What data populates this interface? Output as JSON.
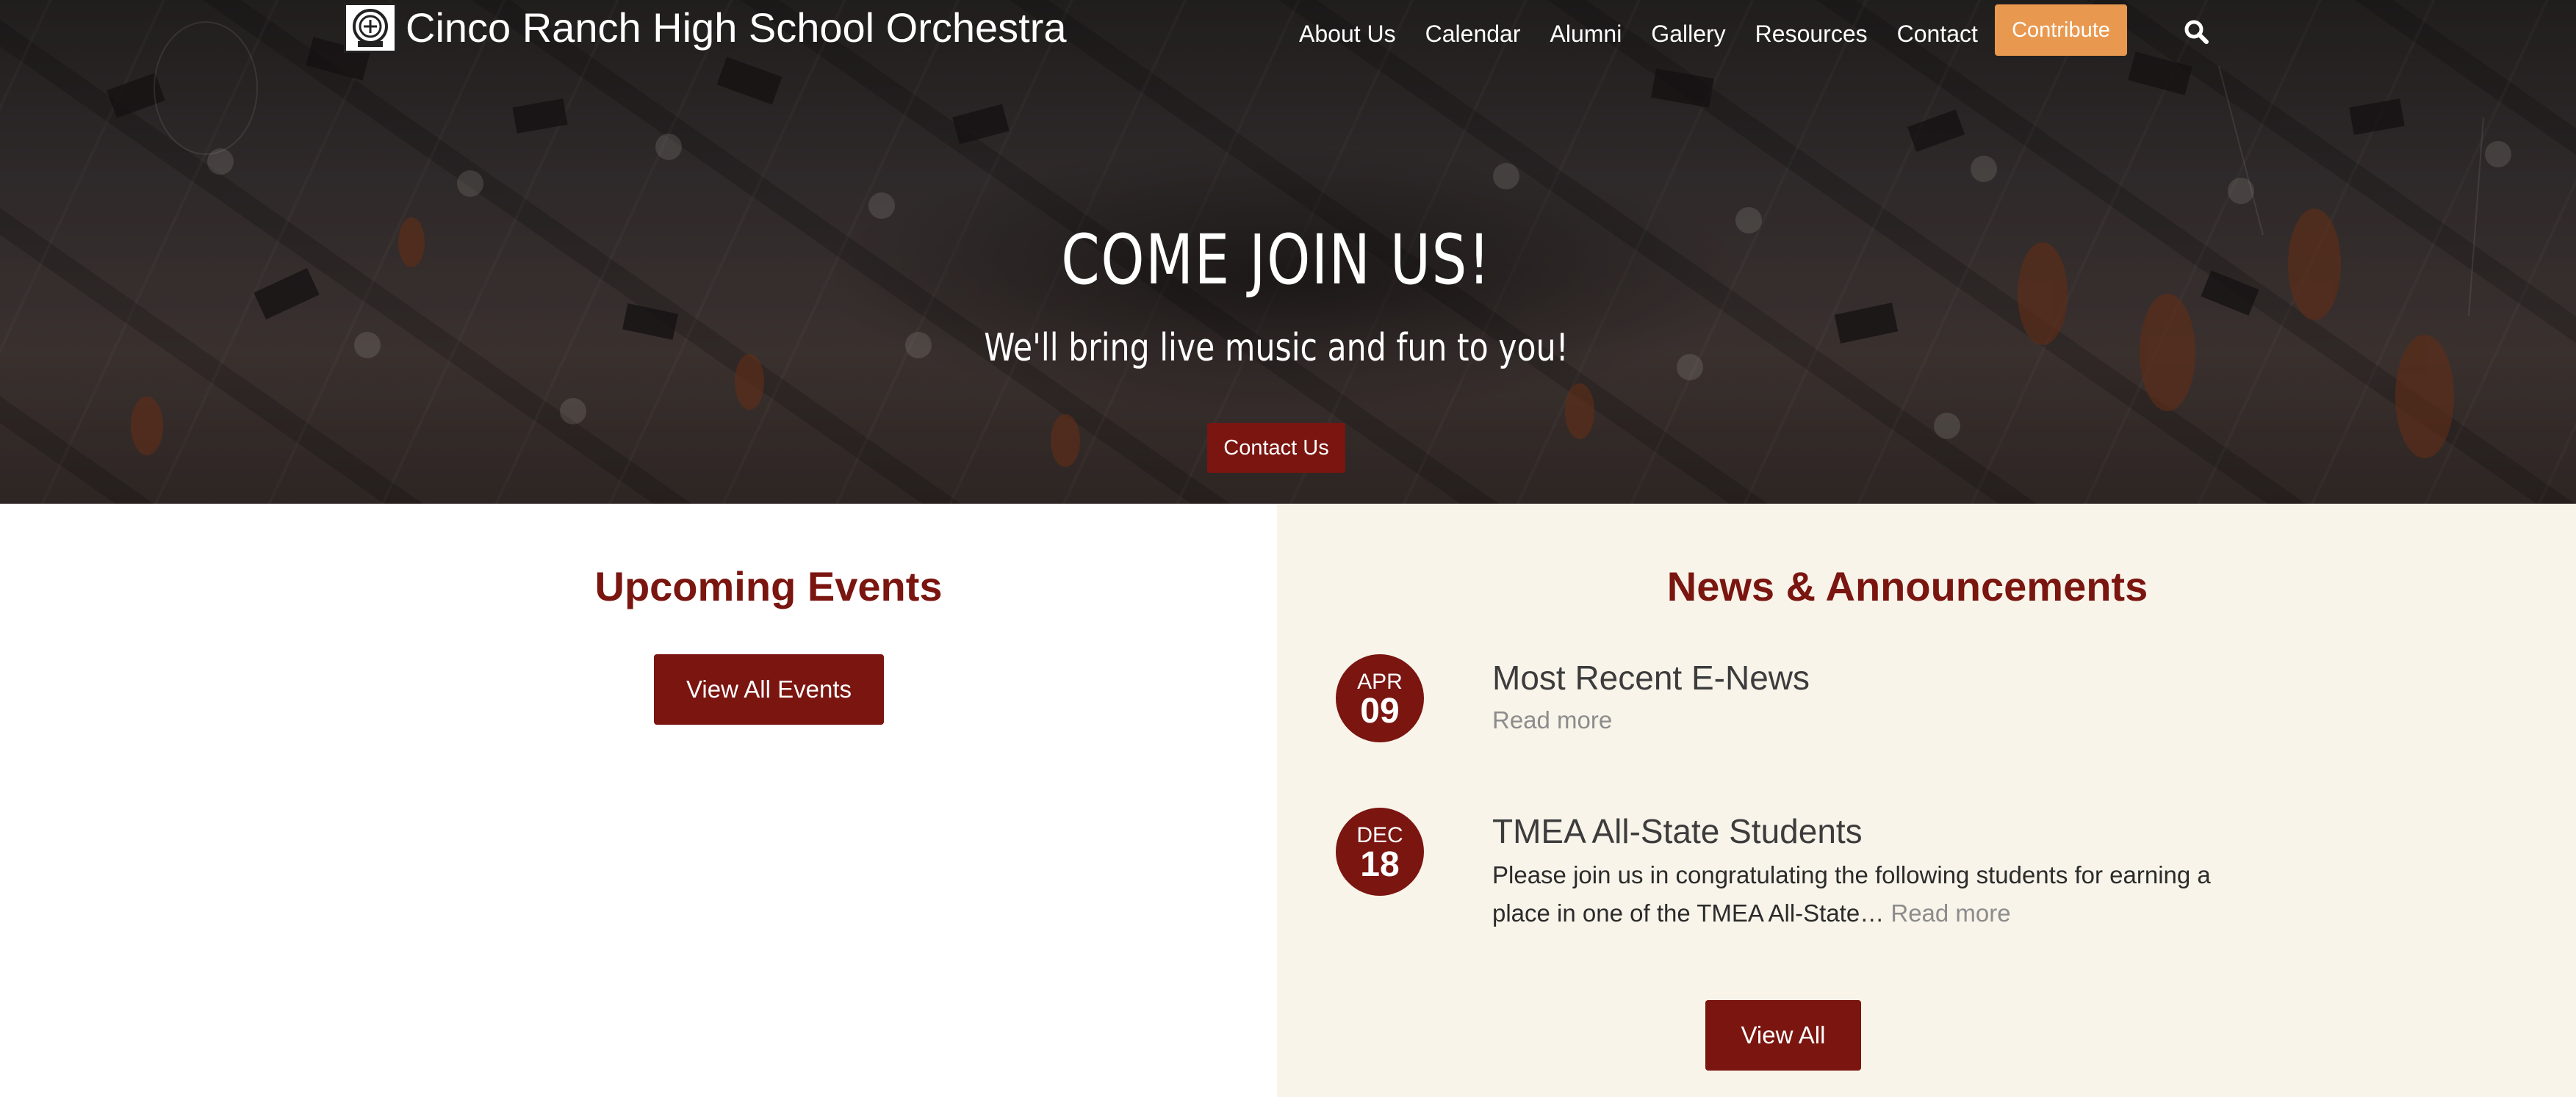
{
  "header": {
    "site_title": "Cinco Ranch High School Orchestra",
    "nav": [
      "About Us",
      "Calendar",
      "Alumni",
      "Gallery",
      "Resources",
      "Contact"
    ],
    "contribute_label": "Contribute",
    "search_icon": "search-icon"
  },
  "hero": {
    "title": "COME JOIN US!",
    "subtitle": "We'll bring live music and fun to you!",
    "cta_label": "Contact Us"
  },
  "events": {
    "heading": "Upcoming Events",
    "view_all_label": "View All Events"
  },
  "news": {
    "heading": "News & Announcements",
    "items": [
      {
        "month": "APR",
        "day": "09",
        "title": "Most Recent E-News",
        "excerpt": "",
        "read_more": "Read more"
      },
      {
        "month": "DEC",
        "day": "18",
        "title": "TMEA All-State Students",
        "excerpt": "Please join us in congratulating the following students for earning a place in one of the TMEA All-State…",
        "read_more": "Read more"
      }
    ],
    "view_all_label": "View All"
  },
  "colors": {
    "primary": "#7a1510",
    "accent": "#e8994f",
    "news_background": "#f9f4ea"
  }
}
